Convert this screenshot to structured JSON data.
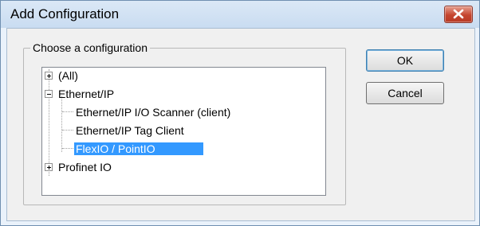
{
  "window": {
    "title": "Add Configuration",
    "close_icon": "close-icon"
  },
  "group": {
    "label": "Choose a configuration"
  },
  "tree": {
    "nodes": [
      {
        "label": "(All)",
        "expander": "plus",
        "selected": false
      },
      {
        "label": "Ethernet/IP",
        "expander": "minus",
        "selected": false
      },
      {
        "label": "Ethernet/IP I/O Scanner (client)",
        "selected": false
      },
      {
        "label": "Ethernet/IP Tag Client",
        "selected": false
      },
      {
        "label": "FlexIO / PointIO",
        "selected": true
      },
      {
        "label": "Profinet IO",
        "expander": "plus",
        "selected": false
      }
    ]
  },
  "buttons": {
    "ok_label": "OK",
    "cancel_label": "Cancel"
  },
  "colors": {
    "selection": "#3399ff",
    "close_button": "#c5452f"
  }
}
